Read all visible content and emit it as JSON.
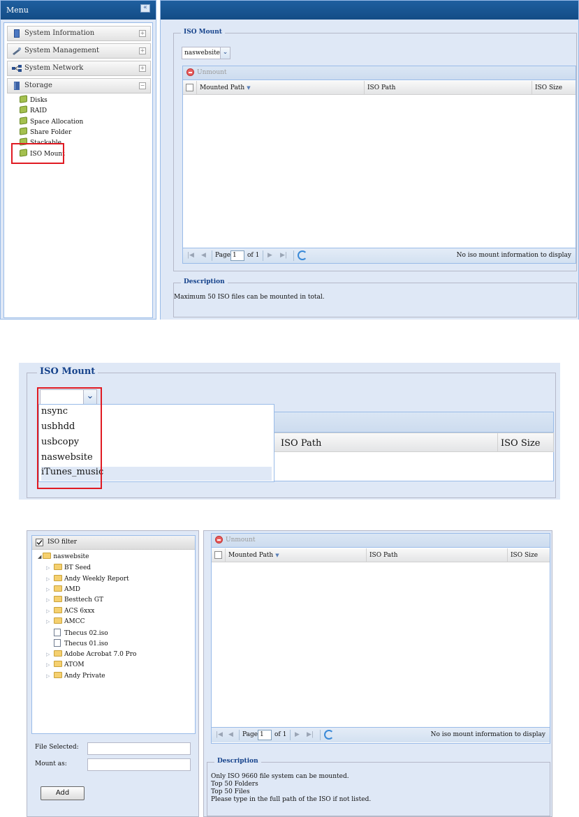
{
  "panel1": {
    "menu_title": "Menu",
    "collapse_glyph": "«",
    "menu_items": [
      {
        "label": "System Information",
        "icon": "book-icon"
      },
      {
        "label": "System Management",
        "icon": "wrench-icon"
      },
      {
        "label": "System Network",
        "icon": "network-icon"
      },
      {
        "label": "Storage",
        "icon": "storage-icon"
      }
    ],
    "storage_sub_items": [
      "Disks",
      "RAID",
      "Space Allocation",
      "Share Folder",
      "Stackable",
      "ISO Mount"
    ],
    "highlighted_item": "ISO Mount",
    "iso_mount_legend": "ISO Mount",
    "folder_combo_value": "naswebsite",
    "unmount_label": "Unmount",
    "columns": {
      "mounted_path": "Mounted Path",
      "iso_path": "ISO Path",
      "iso_size": "ISO Size"
    },
    "paging": {
      "page_label": "Page",
      "page_value": "1",
      "of_label": "of 1",
      "status": "No iso mount information to display"
    },
    "description_legend": "Description",
    "description_text": "Maximum 50 ISO files can be mounted in total."
  },
  "panel2": {
    "legend": "ISO Mount",
    "options": [
      "nsync",
      "usbhdd",
      "usbcopy",
      "naswebsite",
      "iTunes_music"
    ],
    "selected_option": "iTunes_music",
    "col_iso_path": "ISO Path",
    "col_iso_size": "ISO Size"
  },
  "panel3": {
    "filter_label": "ISO filter",
    "root_folder": "naswebsite",
    "tree_items": [
      {
        "label": "BT Seed",
        "type": "folder"
      },
      {
        "label": "Andy Weekly Report",
        "type": "folder"
      },
      {
        "label": "AMD",
        "type": "folder"
      },
      {
        "label": "Besttech GT",
        "type": "folder"
      },
      {
        "label": "ACS 6xxx",
        "type": "folder"
      },
      {
        "label": "AMCC",
        "type": "folder"
      },
      {
        "label": "Thecus 02.iso",
        "type": "iso"
      },
      {
        "label": "Thecus 01.iso",
        "type": "iso"
      },
      {
        "label": "Adobe Acrobat 7.0 Pro",
        "type": "folder"
      },
      {
        "label": "ATOM",
        "type": "folder"
      },
      {
        "label": "Andy Private",
        "type": "folder"
      }
    ],
    "file_selected_label": "File Selected:",
    "mount_as_label": "Mount as:",
    "add_label": "Add",
    "unmount_label": "Unmount",
    "columns": {
      "mounted_path": "Mounted Path",
      "iso_path": "ISO Path",
      "iso_size": "ISO Size"
    },
    "paging": {
      "page_label": "Page",
      "page_value": "1",
      "of_label": "of 1",
      "status": "No iso mount information to display"
    },
    "description_legend": "Description",
    "description_lines": [
      "Only ISO 9660 file system can be mounted.",
      "Top 50 Folders",
      "Top 50 Files",
      "Please type in the full path of the ISO if not listed."
    ]
  },
  "colors": {
    "header_blue": "#134c86",
    "panel_bg": "#dfe8f6",
    "highlight_red": "#e01a22",
    "legend_blue": "#15428b"
  }
}
